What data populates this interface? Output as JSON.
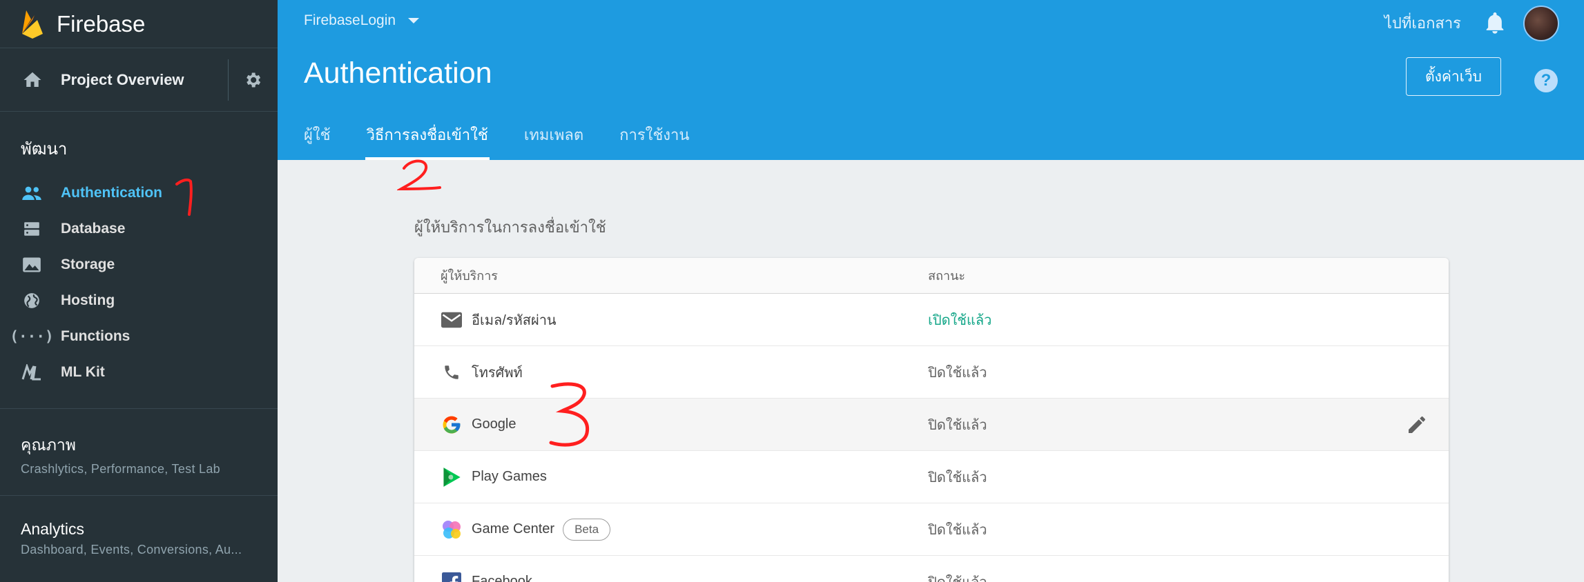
{
  "sidebar": {
    "brand": "Firebase",
    "project_overview": "Project Overview",
    "develop_title": "พัฒนา",
    "items": [
      {
        "label": "Authentication",
        "icon": "people-icon",
        "active": true
      },
      {
        "label": "Database",
        "icon": "database-icon",
        "active": false
      },
      {
        "label": "Storage",
        "icon": "image-icon",
        "active": false
      },
      {
        "label": "Hosting",
        "icon": "globe-icon",
        "active": false
      },
      {
        "label": "Functions",
        "icon": "functions-icon",
        "active": false
      },
      {
        "label": "ML Kit",
        "icon": "mlkit-icon",
        "active": false
      }
    ],
    "quality": {
      "title": "คุณภาพ",
      "subtitle": "Crashlytics, Performance, Test Lab"
    },
    "analytics": {
      "title": "Analytics",
      "subtitle": "Dashboard, Events, Conversions, Au..."
    }
  },
  "header": {
    "project": "FirebaseLogin",
    "docs_link": "ไปที่เอกสาร",
    "title": "Authentication",
    "setup_button": "ตั้งค่าเว็บ",
    "help": "?",
    "tabs": [
      {
        "label": "ผู้ใช้",
        "active": false
      },
      {
        "label": "วิธีการลงชื่อเข้าใช้",
        "active": true
      },
      {
        "label": "เทมเพลต",
        "active": false
      },
      {
        "label": "การใช้งาน",
        "active": false
      }
    ]
  },
  "main": {
    "heading": "ผู้ให้บริการในการลงชื่อเข้าใช้",
    "columns": {
      "provider": "ผู้ให้บริการ",
      "status": "สถานะ"
    },
    "rows": [
      {
        "name": "อีเมล/รหัสผ่าน",
        "icon": "mail-icon",
        "status": "เปิดใช้แล้ว",
        "enabled": true
      },
      {
        "name": "โทรศัพท์",
        "icon": "phone-icon",
        "status": "ปิดใช้แล้ว",
        "enabled": false
      },
      {
        "name": "Google",
        "icon": "google-icon",
        "status": "ปิดใช้แล้ว",
        "enabled": false
      },
      {
        "name": "Play Games",
        "icon": "play-games-icon",
        "status": "ปิดใช้แล้ว",
        "enabled": false
      },
      {
        "name": "Game Center",
        "icon": "game-center-icon",
        "status": "ปิดใช้แล้ว",
        "enabled": false,
        "badge": "Beta"
      },
      {
        "name": "Facebook",
        "icon": "facebook-icon",
        "status": "ปิดใช้แล้ว",
        "enabled": false
      }
    ]
  },
  "annotations": [
    "1",
    "2",
    "3"
  ],
  "colors": {
    "header": "#1e9be0",
    "sidebar": "#263238",
    "active": "#4fc3f7",
    "enabled": "#13a688",
    "annotation": "#ff1f1f"
  }
}
